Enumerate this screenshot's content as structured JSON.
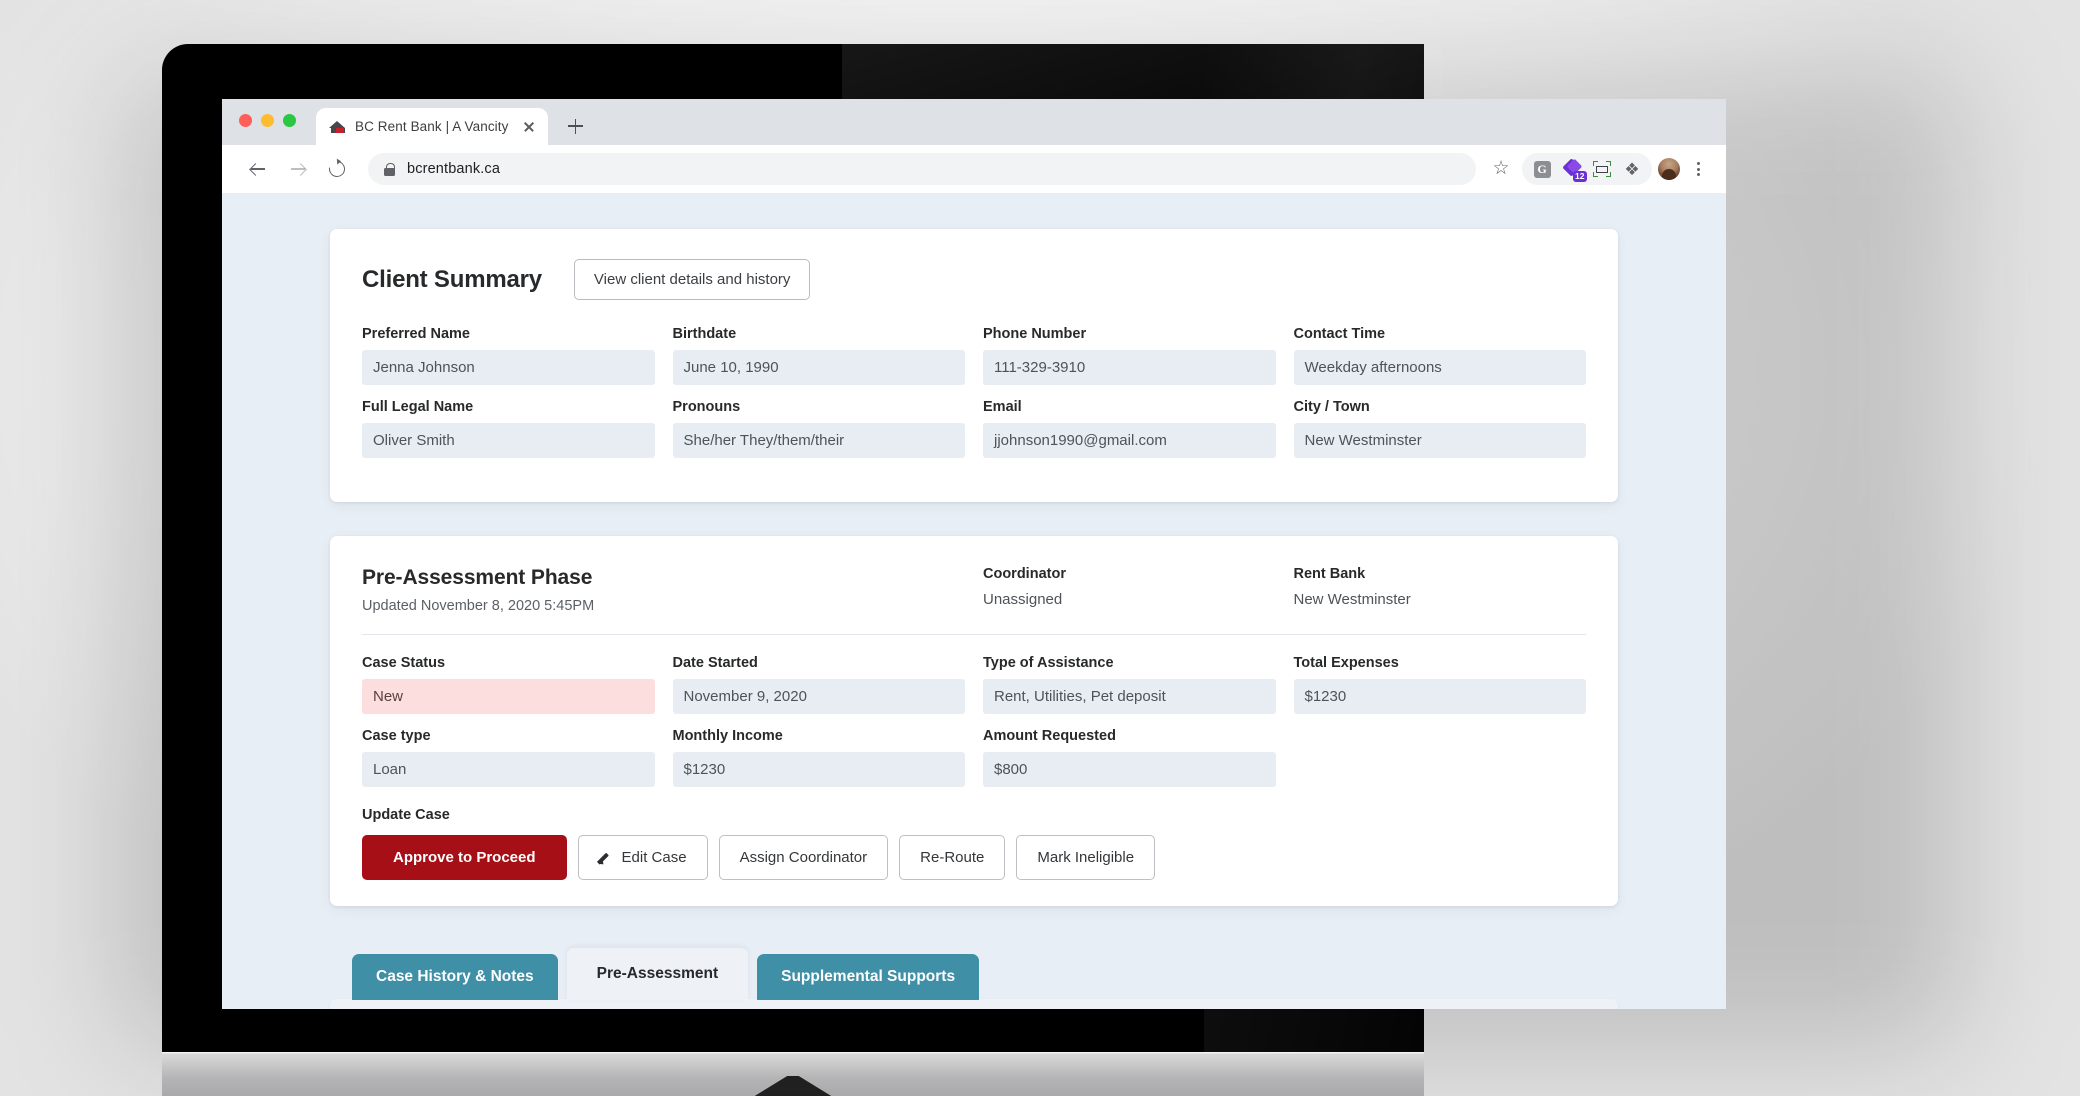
{
  "browser": {
    "tab_title": "BC Rent Bank | A Vancity Comm",
    "favicon_name": "house-roof-favicon",
    "url": "bcrentbank.ca",
    "new_tab_label": "+",
    "extensions": [
      {
        "name": "grammarly-extension-icon",
        "label": "G"
      },
      {
        "name": "purple-diamond-extension-icon",
        "badge": "12"
      },
      {
        "name": "screenshot-crop-extension-icon"
      },
      {
        "name": "puzzle-extensions-icon",
        "glyph": "❖"
      }
    ],
    "profile_name": "profile-avatar",
    "menu_name": "chrome-menu-kebab"
  },
  "client_summary": {
    "title": "Client Summary",
    "view_details_button": "View client details and history",
    "fields": [
      {
        "label": "Preferred Name",
        "value": "Jenna Johnson"
      },
      {
        "label": "Birthdate",
        "value": "June 10, 1990"
      },
      {
        "label": "Phone Number",
        "value": "111-329-3910"
      },
      {
        "label": "Contact Time",
        "value": "Weekday afternoons"
      },
      {
        "label": "Full Legal Name",
        "value": "Oliver Smith"
      },
      {
        "label": "Pronouns",
        "value": "She/her They/them/their"
      },
      {
        "label": "Email",
        "value": "jjohnson1990@gmail.com"
      },
      {
        "label": "City / Town",
        "value": "New Westminster"
      }
    ]
  },
  "phase": {
    "title": "Pre-Assessment Phase",
    "updated": "Updated November 8, 2020 5:45PM",
    "coordinator_label": "Coordinator",
    "coordinator_value": "Unassigned",
    "rent_bank_label": "Rent Bank",
    "rent_bank_value": "New Westminster",
    "fields": [
      {
        "label": "Case Status",
        "value": "New",
        "highlight": "status"
      },
      {
        "label": "Date Started",
        "value": "November 9, 2020"
      },
      {
        "label": "Type of Assistance",
        "value": "Rent, Utilities, Pet deposit"
      },
      {
        "label": "Total Expenses",
        "value": "$1230"
      },
      {
        "label": "Case type",
        "value": "Loan"
      },
      {
        "label": "Monthly Income",
        "value": "$1230"
      },
      {
        "label": "Amount Requested",
        "value": "$800"
      },
      {
        "label": "",
        "value": ""
      }
    ],
    "update_case_label": "Update Case",
    "buttons": [
      {
        "label": "Approve to Proceed",
        "style": "primary"
      },
      {
        "label": "Edit Case",
        "icon": "pencil-icon"
      },
      {
        "label": "Assign Coordinator"
      },
      {
        "label": "Re-Route"
      },
      {
        "label": "Mark Ineligible"
      }
    ]
  },
  "tabs": [
    {
      "label": "Case History & Notes",
      "active": false
    },
    {
      "label": "Pre-Assessment",
      "active": true
    },
    {
      "label": "Supplemental Supports",
      "active": false
    }
  ],
  "colors": {
    "primary_red": "#a60f15",
    "tab_teal": "#3f8fa6",
    "status_pink": "#fcdede",
    "field_bg": "#e7edf3",
    "page_bg": "#e8eef5"
  }
}
